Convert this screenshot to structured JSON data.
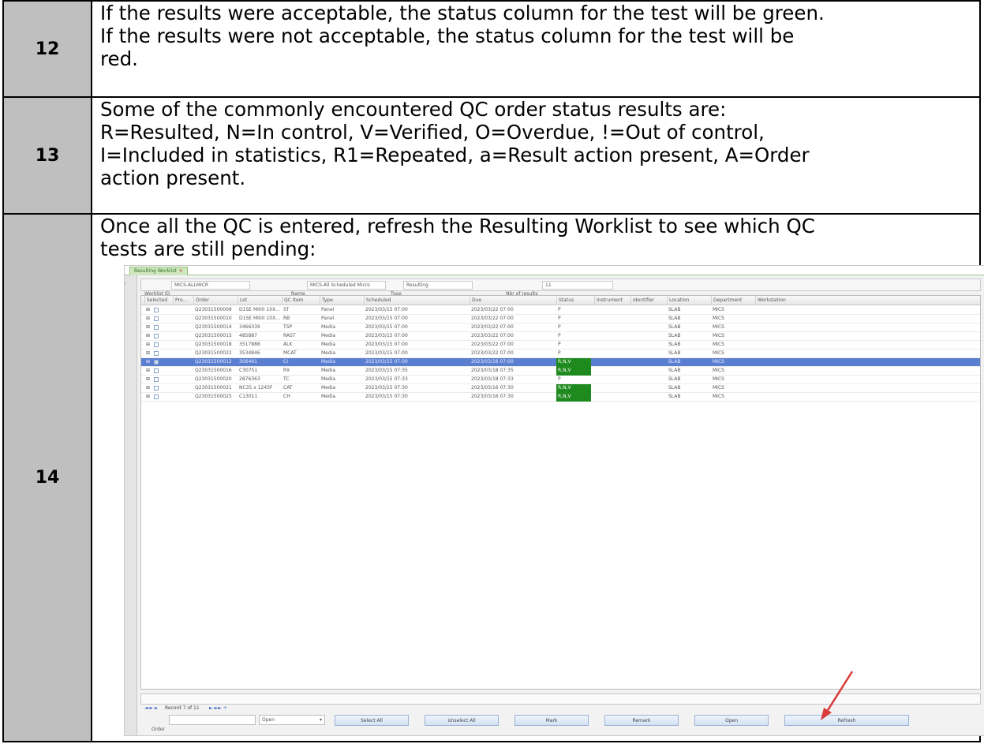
{
  "rows": [
    {
      "step": "12",
      "lines": [
        "If the results were acceptable, the status column for the test will be green.",
        "If the results were not acceptable, the status column for the test will be",
        "red."
      ]
    },
    {
      "step": "13",
      "lines": [
        "Some of the commonly encountered QC order status results are:",
        "R=Resulted, N=In control, V=Verified, O=Overdue, !=Out of control,",
        "I=Included in statistics, R1=Repeated, a=Result action present, A=Order",
        "action present."
      ]
    },
    {
      "step": "14",
      "lines": [
        "Once all the QC is entered, refresh the Resulting Worklist to see which QC",
        "tests are still pending:"
      ]
    }
  ],
  "screenshot": {
    "tab_label": "Resulting Worklist",
    "sidebar_label": "Browser",
    "filter": {
      "worklist_id_label": "Worklist ID",
      "worklist_id_value": "MICS-ALLMICR",
      "name_label": "Name",
      "name_value": "MICS-All Scheduled Micro",
      "type_label": "Type",
      "type_value": "Resulting",
      "records_label": "Nbr of results",
      "records_value": "11"
    },
    "columns": [
      "Selected",
      "Pro...",
      "Order",
      "Lot",
      "QC Item",
      "Type",
      "Scheduled",
      "Due",
      "Status",
      "Instrument",
      "Identifier",
      "Location",
      "Department",
      "Workstation"
    ],
    "grid_rows": [
      {
        "order": "Q23031500009",
        "lot": "D1SE MI00 10X...",
        "item": "ST",
        "type": "Panel",
        "sched": "2023/03/15 07:00",
        "due": "2023/03/22 07:00",
        "status": "P",
        "loc": "SLAB",
        "dept": "MICS",
        "sel": false,
        "green": false
      },
      {
        "order": "Q23031500010",
        "lot": "D1SE MI00 10X...",
        "item": "RB",
        "type": "Panel",
        "sched": "2023/03/15 07:00",
        "due": "2023/03/22 07:00",
        "status": "P",
        "loc": "SLAB",
        "dept": "MICS",
        "sel": false,
        "green": false
      },
      {
        "order": "Q23031500014",
        "lot": "3466339",
        "item": "TSP",
        "type": "Media",
        "sched": "2023/03/15 07:00",
        "due": "2023/03/22 07:00",
        "status": "P",
        "loc": "SLAB",
        "dept": "MICS",
        "sel": false,
        "green": false
      },
      {
        "order": "Q23031500015",
        "lot": "485887",
        "item": "RAST",
        "type": "Media",
        "sched": "2023/03/15 07:00",
        "due": "2023/03/22 07:00",
        "status": "P",
        "loc": "SLAB",
        "dept": "MICS",
        "sel": false,
        "green": false
      },
      {
        "order": "Q23031500018",
        "lot": "3517888",
        "item": "ALK",
        "type": "Media",
        "sched": "2023/03/15 07:00",
        "due": "2023/03/22 07:00",
        "status": "P",
        "loc": "SLAB",
        "dept": "MICS",
        "sel": false,
        "green": false
      },
      {
        "order": "Q23031500022",
        "lot": "3534846",
        "item": "MCAT",
        "type": "Media",
        "sched": "2023/03/15 07:00",
        "due": "2023/03/22 07:00",
        "status": "P",
        "loc": "SLAB",
        "dept": "MICS",
        "sel": false,
        "green": false
      },
      {
        "order": "Q23031500012",
        "lot": "306491",
        "item": "CI",
        "type": "Media",
        "sched": "2023/03/15 07:00",
        "due": "2023/03/16 07:00",
        "status": "R,N,V",
        "loc": "SLAB",
        "dept": "MICS",
        "sel": true,
        "green": true
      },
      {
        "order": "Q23031500016",
        "lot": "C30751",
        "item": "RX",
        "type": "Media",
        "sched": "2023/03/15 07:35",
        "due": "2023/03/18 07:35",
        "status": "R,N,V",
        "loc": "SLAB",
        "dept": "MICS",
        "sel": false,
        "green": true
      },
      {
        "order": "Q23031500020",
        "lot": "2876363",
        "item": "TC",
        "type": "Media",
        "sched": "2023/03/15 07:33",
        "due": "2023/03/18 07:33",
        "status": "P",
        "loc": "SLAB",
        "dept": "MICS",
        "sel": false,
        "green": false
      },
      {
        "order": "Q23031500021",
        "lot": "NC35 x 1243F",
        "item": "CAT",
        "type": "Media",
        "sched": "2023/03/15 07:30",
        "due": "2023/03/16 07:30",
        "status": "R,N,V",
        "loc": "SLAB",
        "dept": "MICS",
        "sel": false,
        "green": true
      },
      {
        "order": "Q23031500025",
        "lot": "C13011",
        "item": "CH",
        "type": "Media",
        "sched": "2023/03/15 07:30",
        "due": "2023/03/16 07:30",
        "status": "R,N,V",
        "loc": "SLAB",
        "dept": "MICS",
        "sel": false,
        "green": true
      }
    ],
    "pager_text": "Record 7 of 11",
    "bottom": {
      "order_label": "Order",
      "status_value": "Open",
      "buttons": [
        "Select All",
        "Unselect All",
        "Mark",
        "Remark",
        "Open",
        "Refresh"
      ]
    }
  }
}
